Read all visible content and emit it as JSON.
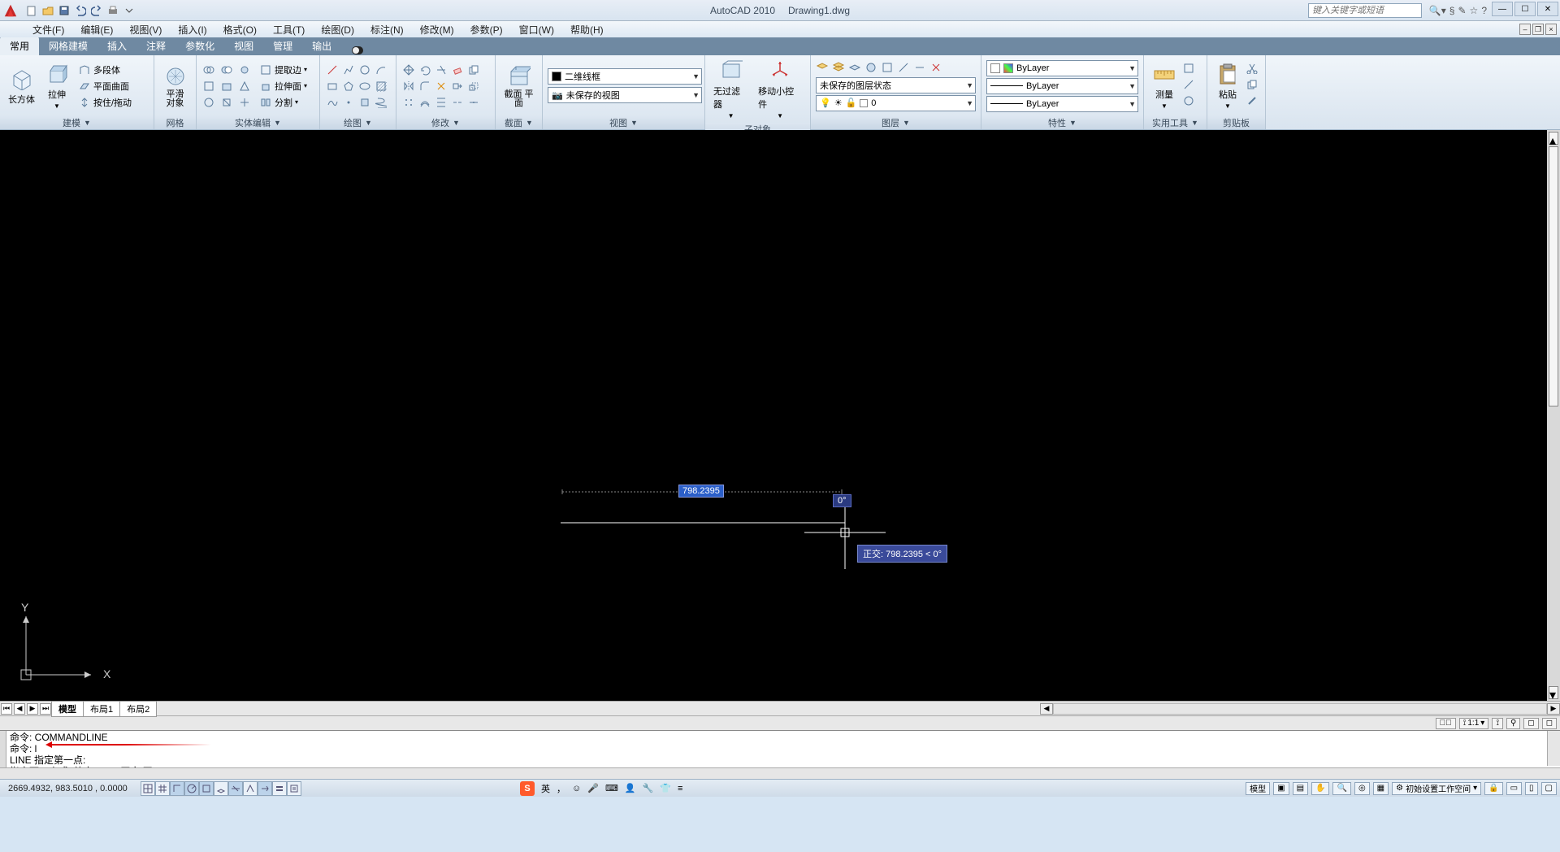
{
  "app": {
    "name": "AutoCAD 2010",
    "doc": "Drawing1.dwg"
  },
  "search_placeholder": "键入关键字或短语",
  "menus": [
    "文件(F)",
    "编辑(E)",
    "视图(V)",
    "插入(I)",
    "格式(O)",
    "工具(T)",
    "绘图(D)",
    "标注(N)",
    "修改(M)",
    "参数(P)",
    "窗口(W)",
    "帮助(H)"
  ],
  "ribbon_tabs": [
    "常用",
    "网格建模",
    "插入",
    "注释",
    "参数化",
    "视图",
    "管理",
    "输出"
  ],
  "active_tab": 0,
  "groups": {
    "model": {
      "label": "建模",
      "big1": "长方体",
      "big2": "拉伸",
      "items": [
        "多段体",
        "平面曲面",
        "按住/拖动"
      ]
    },
    "mesh": {
      "label": "网格",
      "big": "平滑\n对象"
    },
    "solidedit": {
      "label": "实体编辑",
      "items": [
        "提取边",
        "拉伸面",
        "分割"
      ]
    },
    "draw": {
      "label": "绘图"
    },
    "modify": {
      "label": "修改"
    },
    "section": {
      "label": "截面",
      "big1": "截面\n平面"
    },
    "view": {
      "label": "视图",
      "combo1": "二维线框",
      "combo2": "未保存的视图"
    },
    "subobj": {
      "label": "子对象",
      "big1": "无过滤器",
      "big2": "移动小控件"
    },
    "layer": {
      "label": "图层",
      "combo": "未保存的图层状态",
      "cur": "0"
    },
    "props": {
      "label": "特性",
      "v1": "ByLayer",
      "v2": "ByLayer",
      "v3": "ByLayer"
    },
    "utils": {
      "label": "实用工具",
      "big": "测量"
    },
    "clip": {
      "label": "剪贴板",
      "big": "粘贴"
    }
  },
  "drawing": {
    "dim_value": "798.2395",
    "angle_value": "0°",
    "tooltip": "正交: 798.2395 < 0°"
  },
  "layout_tabs": [
    "模型",
    "布局1",
    "布局2"
  ],
  "active_layout": 0,
  "anno": {
    "scale": "1:1"
  },
  "command": {
    "l1": "命令: COMMANDLINE",
    "l2": "命令: l",
    "l3": "LINE 指定第一点:",
    "l4": "指定下一点或 [放弃(U)]:  <正交 开>"
  },
  "status": {
    "coords": "2669.4932, 983.5010 , 0.0000",
    "ime_lang": "英",
    "right1": "模型",
    "workspace": "初始设置工作空间"
  }
}
